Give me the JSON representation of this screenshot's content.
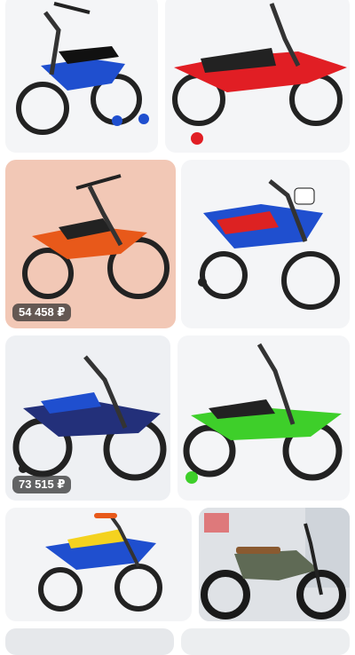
{
  "feed": {
    "items": [
      {
        "image": "blue-moto-kids-bike-front-view",
        "price": ""
      },
      {
        "image": "red-moto-kids-bike-side-view",
        "price": ""
      },
      {
        "image": "orange-moto-kids-bike-pink-background",
        "price": "54 458 ₽"
      },
      {
        "image": "blue-moto-kids-bike-number-199",
        "price": ""
      },
      {
        "image": "blue-black-moto-kids-bike",
        "price": "73 515 ₽"
      },
      {
        "image": "green-moto-kids-bike",
        "price": ""
      },
      {
        "image": "blue-yellow-moto-kids-bike",
        "price": ""
      },
      {
        "image": "black-electric-bike-indoor",
        "price": ""
      }
    ]
  },
  "colors": {
    "blue": "#1f4fcf",
    "red": "#e11e24",
    "orange": "#e8591a",
    "green": "#3ecf2a",
    "navy": "#23307a",
    "dark": "#2b2b2b"
  }
}
